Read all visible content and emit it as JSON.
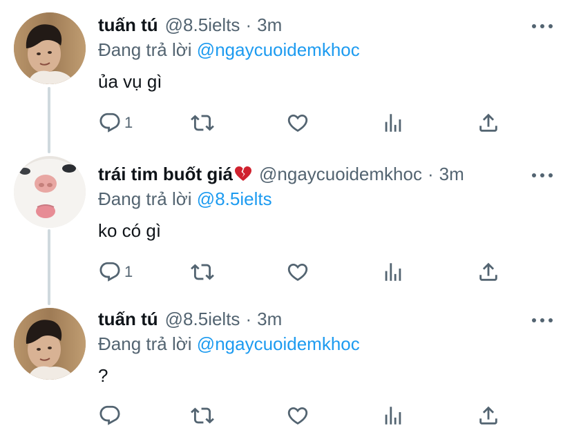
{
  "tweets": [
    {
      "display_name": "tuấn tú",
      "handle": "@8.5ielts",
      "separator": "·",
      "time": "3m",
      "reply_prefix": "Đang trả lời",
      "reply_to": "@ngaycuoidemkhoc",
      "text": "ủa vụ gì",
      "reply_count": "1",
      "avatar": "person-portrait"
    },
    {
      "display_name": "trái tim buốt giá",
      "emoji": "broken-heart-emoji",
      "handle": "@ngaycuoidemkhoc",
      "separator": "·",
      "time": "3m",
      "reply_prefix": "Đang trả lời",
      "reply_to": "@8.5ielts",
      "text": "ko có gì",
      "reply_count": "1",
      "avatar": "cat-closeup"
    },
    {
      "display_name": "tuấn tú",
      "handle": "@8.5ielts",
      "separator": "·",
      "time": "3m",
      "reply_prefix": "Đang trả lời",
      "reply_to": "@ngaycuoidemkhoc",
      "text": "?",
      "reply_count": "",
      "avatar": "person-portrait"
    }
  ],
  "icons": [
    "reply-icon",
    "retweet-icon",
    "like-icon",
    "analytics-icon",
    "share-icon",
    "more-icon"
  ],
  "colors": {
    "accent": "#1d9bf0",
    "secondary_text": "#536471",
    "connector": "#cfd9de"
  }
}
